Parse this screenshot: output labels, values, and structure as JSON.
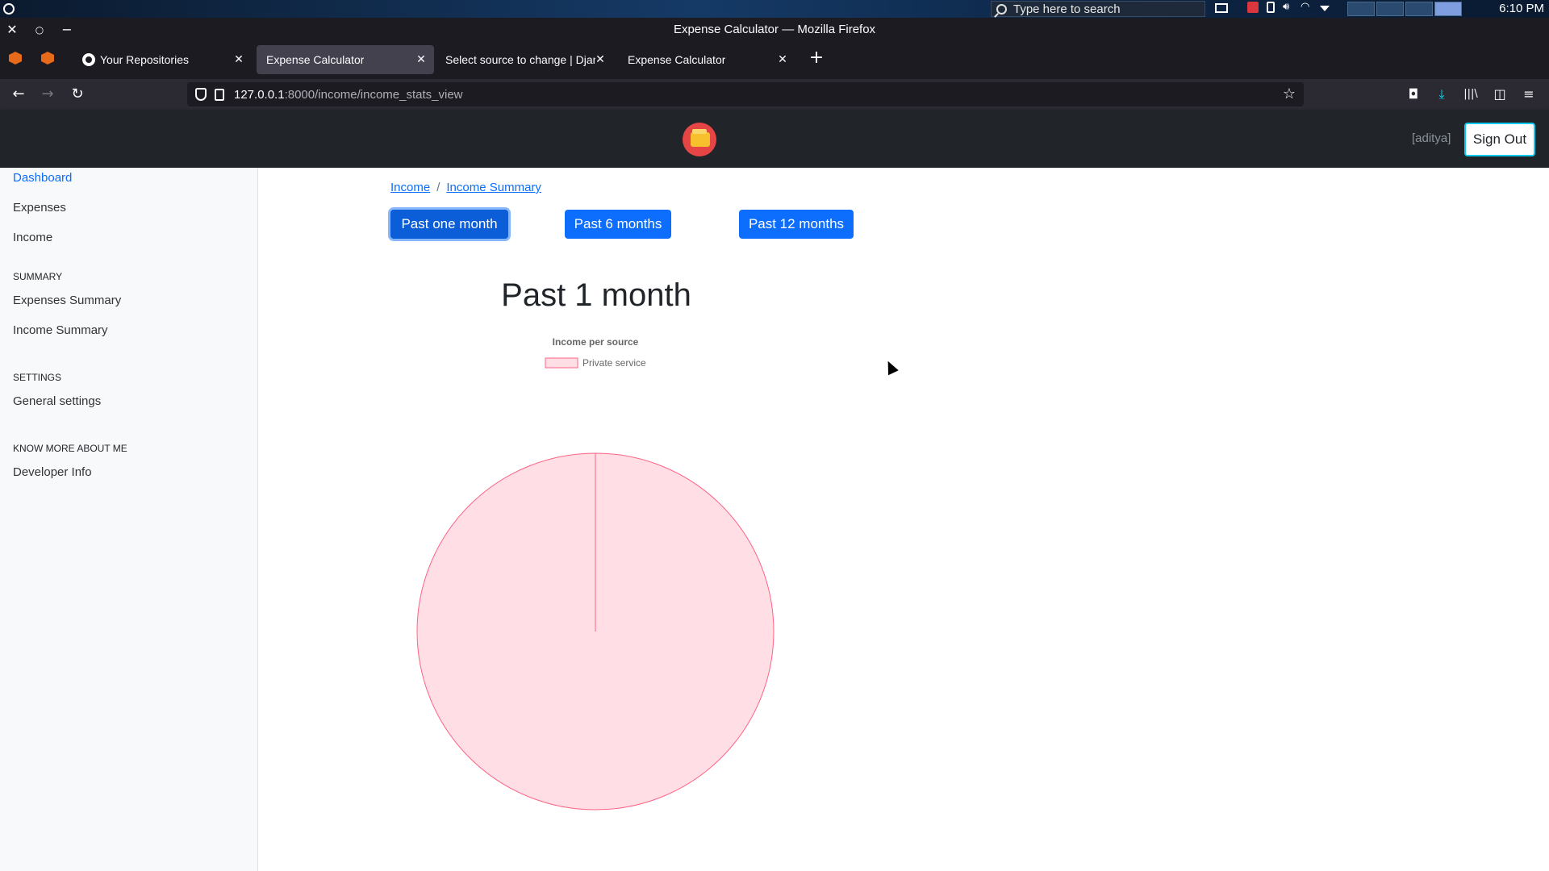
{
  "taskbar": {
    "search_placeholder": "Type here to search",
    "clock": "6:10 PM"
  },
  "window": {
    "title": "Expense Calculator — Mozilla Firefox"
  },
  "tabs": [
    {
      "label": "Your Repositories",
      "active": false
    },
    {
      "label": "Expense Calculator",
      "active": true
    },
    {
      "label": "Select source to change | Django",
      "active": false
    },
    {
      "label": "Expense Calculator",
      "active": false
    }
  ],
  "navbar": {
    "url_host": "127.0.0.1",
    "url_rest": ":8000/income/income_stats_view"
  },
  "header": {
    "username": "[aditya]",
    "signout_label": "Sign Out"
  },
  "sidebar": {
    "links": [
      {
        "label": "Dashboard"
      },
      {
        "label": "Expenses"
      },
      {
        "label": "Income"
      }
    ],
    "summary_heading": "SUMMARY",
    "summary_links": [
      {
        "label": "Expenses Summary"
      },
      {
        "label": "Income Summary"
      }
    ],
    "settings_heading": "SETTINGS",
    "settings_links": [
      {
        "label": "General settings"
      }
    ],
    "about_heading": "KNOW MORE ABOUT ME",
    "about_links": [
      {
        "label": "Developer Info"
      }
    ]
  },
  "main": {
    "breadcrumb": [
      {
        "label": "Income"
      },
      {
        "label": "Income Summary"
      }
    ],
    "breadcrumb_separator": "/",
    "period_buttons": [
      {
        "label": "Past one month"
      },
      {
        "label": "Past 6 months"
      },
      {
        "label": "Past 12 months"
      }
    ],
    "chart_heading": "Past 1 month"
  },
  "chart_data": {
    "type": "pie",
    "title": "Income per source",
    "categories": [
      "Private service"
    ],
    "values": [
      100
    ],
    "colors": {
      "fill": "#ffdee5",
      "stroke": "#ff6384"
    },
    "legend": "top"
  }
}
